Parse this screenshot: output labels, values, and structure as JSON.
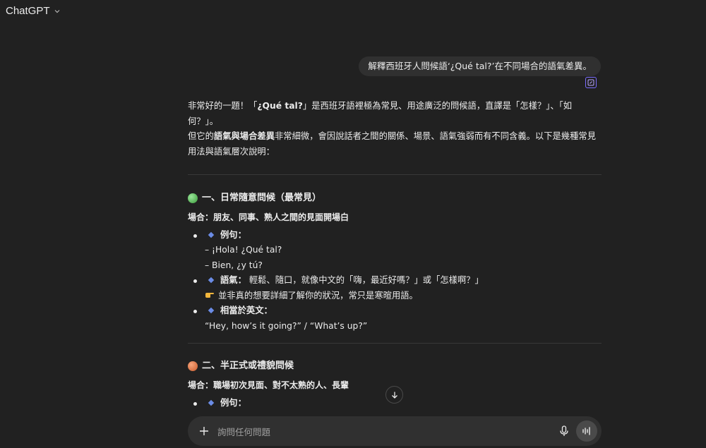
{
  "app": {
    "title": "ChatGPT"
  },
  "user_message": "解釋西班牙人問候語‘¿Qué tal?’在不同場合的語氣差異。",
  "answer": {
    "intro_1": {
      "a": "非常好的一題！「",
      "b": "¿Qué tal?",
      "c": "」是西班牙語裡極為常見、用途廣泛的問候語，直譯是「怎樣？」、「如何？」。"
    },
    "intro_2": {
      "a": "但它的",
      "b": "語氣與場合差異",
      "c": "非常細微，會因說話者之間的關係、場景、語氣強弱而有不同含義。以下是幾種常見用法與語氣層次說明："
    },
    "section1": {
      "heading": "一、日常隨意問候（最常見）",
      "scene": "場合：朋友、同事、熟人之間的見面開場白",
      "example_label": "例句：",
      "example_lines": [
        "– ¡Hola! ¿Qué tal?",
        "– Bien, ¿y tú?"
      ],
      "tone_label": "語氣：",
      "tone_text": "輕鬆、隨口，就像中文的「嗨，最近好嗎？」或「怎樣啊？」",
      "tone_note": "並非真的想要詳細了解你的狀況，常只是寒暄用語。",
      "equiv_label": "相當於英文：",
      "equiv_text": "“Hey, how’s it going?” / “What’s up?”"
    },
    "section2": {
      "heading": "二、半正式或禮貌問候",
      "scene": "場合：職場初次見面、對不太熟的人、長輩",
      "example_label": "例句："
    }
  },
  "composer": {
    "placeholder": "詢問任何問題"
  },
  "colors": {
    "background": "#212121",
    "bubble": "#303030",
    "diamond": "#6b8ce6",
    "green_dot": "#5cb85c",
    "orange_dot": "#e07b4a"
  },
  "icons": [
    "chevron-down-icon",
    "edit-icon",
    "green-circle-icon",
    "orange-circle-icon",
    "pointing-hand-icon",
    "arrow-down-icon",
    "plus-icon",
    "microphone-icon",
    "voice-mode-icon"
  ]
}
